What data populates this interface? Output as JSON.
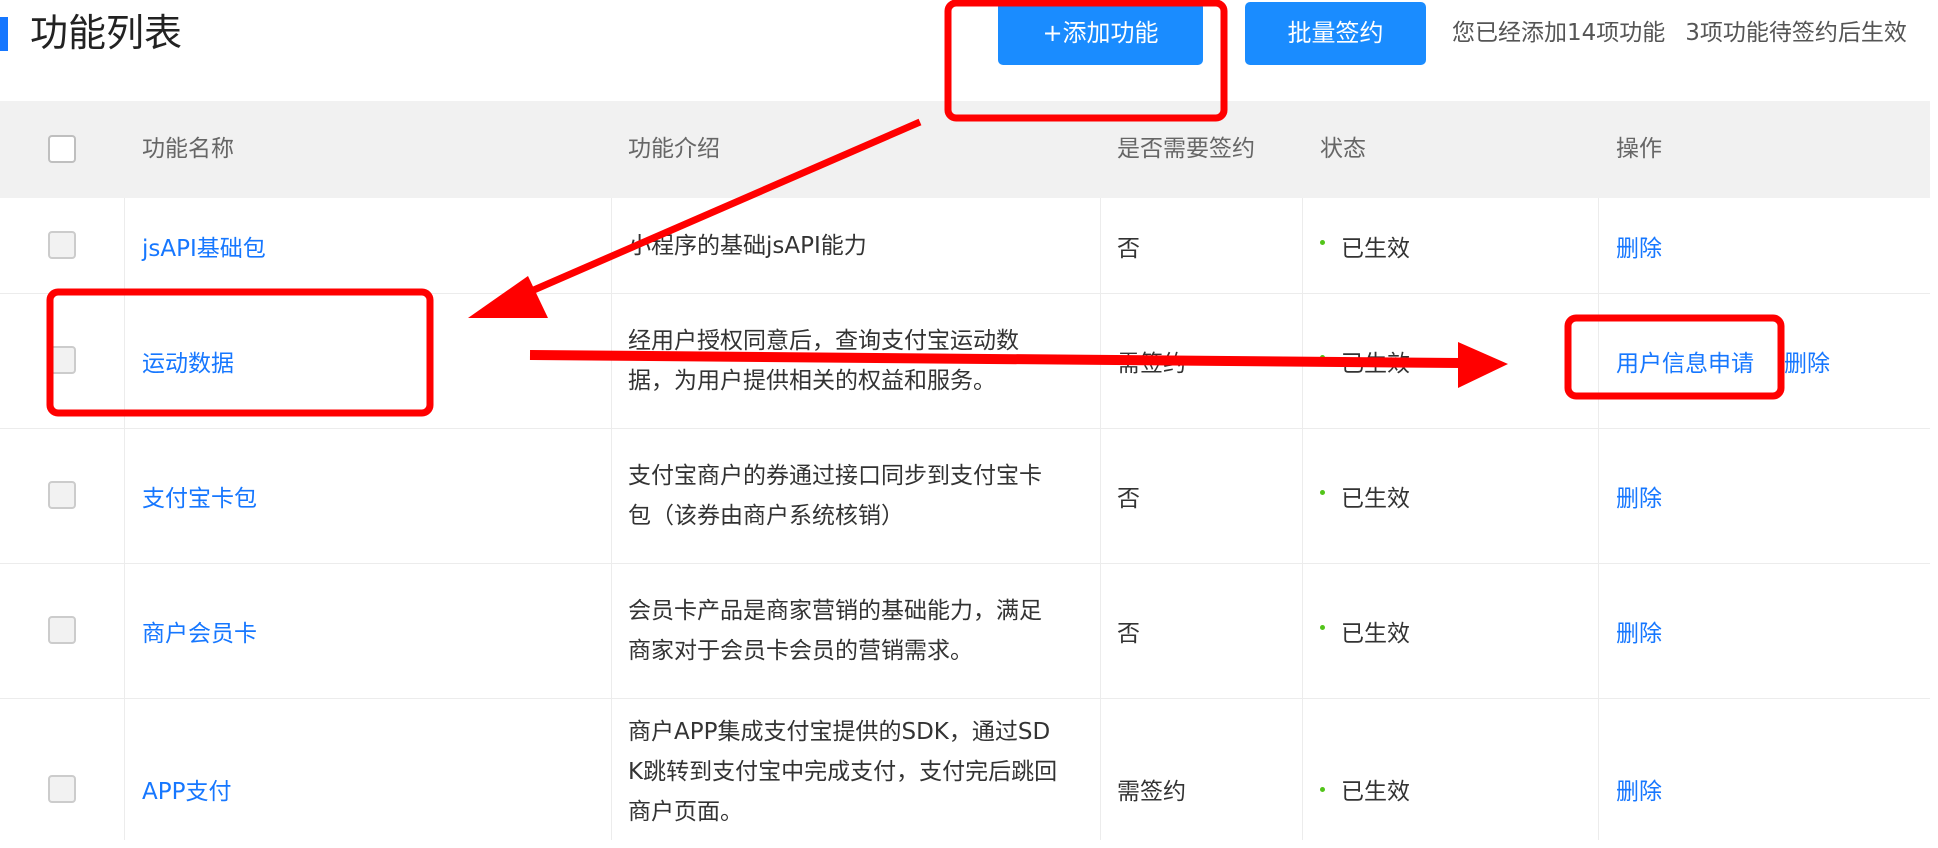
{
  "header": {
    "title": "功能列表",
    "add_button": "+添加功能",
    "batch_button": "批量签约",
    "summary_added": "您已经添加14项功能",
    "summary_pending": "3项功能待签约后生效"
  },
  "table": {
    "columns": [
      "功能名称",
      "功能介绍",
      "是否需要签约",
      "状态",
      "操作"
    ],
    "rows": [
      {
        "name": "jsAPI基础包",
        "desc": [
          "小程序的基础jsAPI能力"
        ],
        "needs_sign": "否",
        "status": "已生效",
        "ops": [
          "删除"
        ]
      },
      {
        "name": "运动数据",
        "desc": [
          "经用户授权同意后，查询支付宝运动数",
          "据，为用户提供相关的权益和服务。"
        ],
        "needs_sign": "需签约",
        "status": "已生效",
        "ops": [
          "用户信息申请",
          "删除"
        ]
      },
      {
        "name": "支付宝卡包",
        "desc": [
          "支付宝商户的券通过接口同步到支付宝卡",
          "包（该券由商户系统核销）"
        ],
        "needs_sign": "否",
        "status": "已生效",
        "ops": [
          "删除"
        ]
      },
      {
        "name": "商户会员卡",
        "desc": [
          "会员卡产品是商家营销的基础能力，满足",
          "商家对于会员卡会员的营销需求。"
        ],
        "needs_sign": "否",
        "status": "已生效",
        "ops": [
          "删除"
        ]
      },
      {
        "name": "APP支付",
        "desc": [
          "商户APP集成支付宝提供的SDK，通过SD",
          "K跳转到支付宝中完成支付，支付完后跳回",
          "商户页面。"
        ],
        "needs_sign": "需签约",
        "status": "已生效",
        "ops": [
          "删除"
        ]
      }
    ]
  },
  "colors": {
    "accent": "#1677ff",
    "annotation": "#ff0000",
    "status_dot": "#52c41a"
  }
}
